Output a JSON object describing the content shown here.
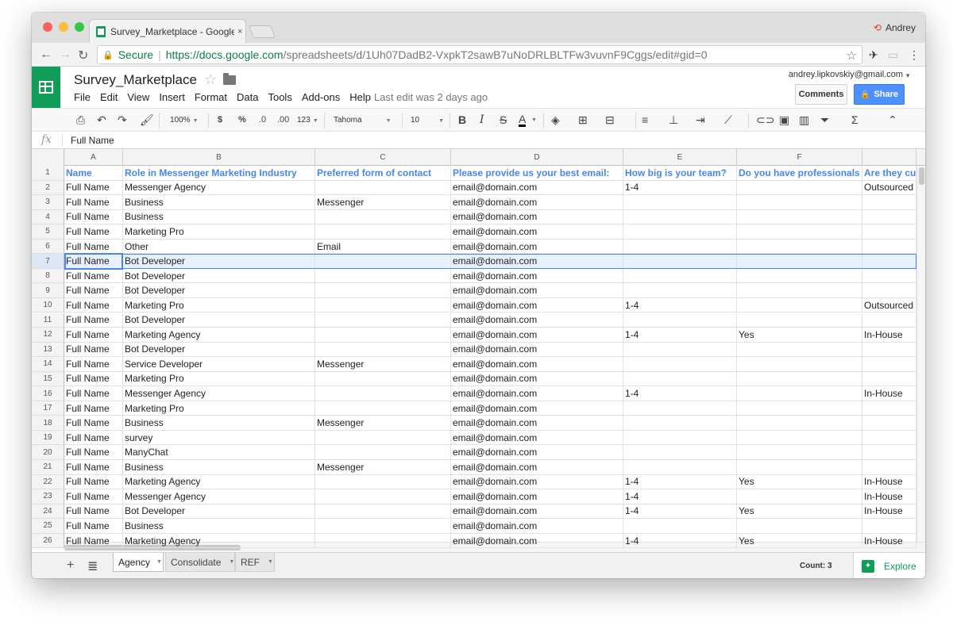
{
  "browser": {
    "tab_title": "Survey_Marketplace - Google S",
    "tab_close": "×",
    "profile_name": "Andrey",
    "secure_label": "Secure",
    "url_host": "https://docs.google.com",
    "url_path": "/spreadsheets/d/1Uh07DadB2-VxpkT2sawB7uNoDRLBLTFw3vuvnF9Cggs/edit#gid=0"
  },
  "doc": {
    "title": "Survey_Marketplace",
    "menu": [
      "File",
      "Edit",
      "View",
      "Insert",
      "Format",
      "Data",
      "Tools",
      "Add-ons",
      "Help"
    ],
    "last_edit": "Last edit was 2 days ago",
    "account_email": "andrey.lipkovskiy@gmail.com",
    "comments_label": "Comments",
    "share_label": "Share"
  },
  "toolbar": {
    "zoom": "100%",
    "currency": "$",
    "percent": "%",
    "decrease_decimals": ".0",
    "increase_decimals": ".00",
    "more_formats": "123",
    "font": "Tahoma",
    "font_size": "10"
  },
  "formula_bar": {
    "fx": "fx",
    "content": "Full Name"
  },
  "grid": {
    "columns": [
      "A",
      "B",
      "C",
      "D",
      "E",
      "F",
      ""
    ],
    "header_row": [
      "Name",
      "Role in Messenger Marketing Industry",
      "Preferred form of contact",
      "Please provide us your best email:",
      "How big is your team?",
      "Do you have professionals",
      "Are they cu"
    ],
    "rows": [
      [
        "Full Name",
        "Messenger Agency",
        "",
        "email@domain.com",
        "1-4",
        "",
        "Outsourced"
      ],
      [
        "Full Name",
        "Business",
        "Messenger",
        "email@domain.com",
        "",
        "",
        ""
      ],
      [
        "Full Name",
        "Business",
        "",
        "email@domain.com",
        "",
        "",
        ""
      ],
      [
        "Full Name",
        "Marketing Pro",
        "",
        "email@domain.com",
        "",
        "",
        ""
      ],
      [
        "Full Name",
        "Other",
        "Email",
        "email@domain.com",
        "",
        "",
        ""
      ],
      [
        "Full Name",
        "Bot Developer",
        "",
        "email@domain.com",
        "",
        "",
        ""
      ],
      [
        "Full Name",
        "Bot Developer",
        "",
        "email@domain.com",
        "",
        "",
        ""
      ],
      [
        "Full Name",
        "Bot Developer",
        "",
        "email@domain.com",
        "",
        "",
        ""
      ],
      [
        "Full Name",
        "Marketing Pro",
        "",
        "email@domain.com",
        "1-4",
        "",
        "Outsourced"
      ],
      [
        "Full Name",
        "Bot Developer",
        "",
        "email@domain.com",
        "",
        "",
        ""
      ],
      [
        "Full Name",
        "Marketing Agency",
        "",
        "email@domain.com",
        "1-4",
        "Yes",
        "In-House"
      ],
      [
        "Full Name",
        "Bot Developer",
        "",
        "email@domain.com",
        "",
        "",
        ""
      ],
      [
        "Full Name",
        "Service Developer",
        "Messenger",
        "email@domain.com",
        "",
        "",
        ""
      ],
      [
        "Full Name",
        "Marketing Pro",
        "",
        "email@domain.com",
        "",
        "",
        ""
      ],
      [
        "Full Name",
        "Messenger Agency",
        "",
        "email@domain.com",
        "1-4",
        "",
        "In-House"
      ],
      [
        "Full Name",
        "Marketing Pro",
        "",
        "email@domain.com",
        "",
        "",
        ""
      ],
      [
        "Full Name",
        "Business",
        "Messenger",
        "email@domain.com",
        "",
        "",
        ""
      ],
      [
        "Full Name",
        "survey",
        "",
        "email@domain.com",
        "",
        "",
        ""
      ],
      [
        "Full Name",
        "ManyChat",
        "",
        "email@domain.com",
        "",
        "",
        ""
      ],
      [
        "Full Name",
        "Business",
        "Messenger",
        "email@domain.com",
        "",
        "",
        ""
      ],
      [
        "Full Name",
        "Marketing Agency",
        "",
        "email@domain.com",
        "1-4",
        "Yes",
        "In-House"
      ],
      [
        "Full Name",
        "Messenger Agency",
        "",
        "email@domain.com",
        "1-4",
        "",
        "In-House"
      ],
      [
        "Full Name",
        "Bot Developer",
        "",
        "email@domain.com",
        "1-4",
        "Yes",
        "In-House"
      ],
      [
        "Full Name",
        "Business",
        "",
        "email@domain.com",
        "",
        "",
        ""
      ],
      [
        "Full Name",
        "Marketing Agency",
        "",
        "email@domain.com",
        "1-4",
        "Yes",
        "In-House"
      ]
    ],
    "selected_row": 7
  },
  "sheets": {
    "tabs": [
      "Agency",
      "Consolidate",
      "REF"
    ],
    "active": 0,
    "count_label": "Count: 3",
    "explore_label": "Explore"
  },
  "colors": {
    "header_blue": "#4a86e8",
    "sheets_green": "#0f9d58",
    "share_blue": "#4d90fe"
  }
}
